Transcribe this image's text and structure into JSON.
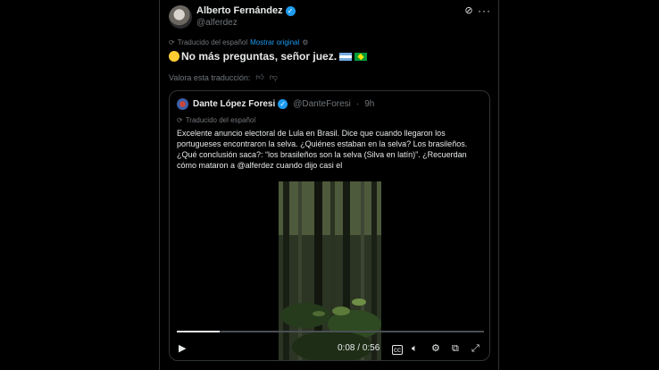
{
  "tweet": {
    "author_name": "Alberto Fernández",
    "handle": "@alferdez",
    "translated_label": "Traducido del español",
    "show_original": "Mostrar original",
    "text": "No más preguntas, señor juez.",
    "rate_label": "Valora esta traducción:"
  },
  "quote": {
    "author_name": "Dante López Foresi",
    "handle": "@DanteForesi",
    "time": "9h",
    "translated_label": "Traducido del español",
    "text": "Excelente anuncio electoral de Lula en Brasil. Dice que cuando llegaron los portugueses encontraron la selva. ¿Quiénes estaban en la selva? Los brasileños. ¿Qué conclusión saca?: “los brasileños son la selva (Silva en latín)”. ¿Recuerdan cómo mataron a @alferdez cuando dijo casi el"
  },
  "video": {
    "current_time": "0:08",
    "duration": "0:56",
    "progress": 0.14
  },
  "colors": {
    "accent": "#1d9bf0",
    "background": "#000000",
    "text": "#e7e9ea",
    "muted": "#71767b"
  },
  "icons": [
    "verified-badge-icon",
    "grok-icon",
    "more-icon",
    "translate-icon",
    "gear-icon",
    "thumbs-up-icon",
    "thumbs-down-icon",
    "play-icon",
    "captions-icon",
    "volume-icon",
    "settings-icon",
    "picture-in-picture-icon",
    "fullscreen-icon"
  ]
}
